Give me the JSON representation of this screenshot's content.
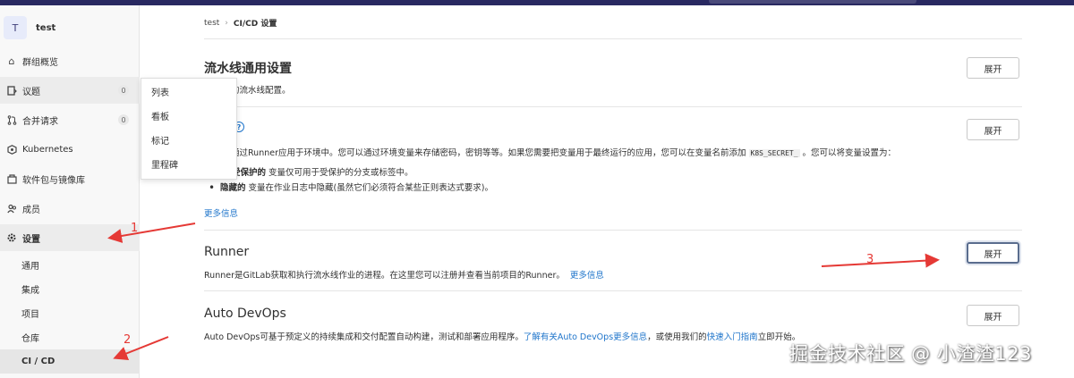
{
  "sidebar": {
    "group": {
      "avatar_letter": "T",
      "name": "test"
    },
    "items": [
      {
        "label": "群组概览",
        "icon": "home-icon"
      },
      {
        "label": "议题",
        "icon": "issues-icon",
        "count": "0"
      },
      {
        "label": "合并请求",
        "icon": "merge-request-icon",
        "count": "0"
      },
      {
        "label": "Kubernetes",
        "icon": "kubernetes-icon"
      },
      {
        "label": "软件包与镜像库",
        "icon": "package-icon"
      },
      {
        "label": "成员",
        "icon": "users-icon"
      },
      {
        "label": "设置",
        "icon": "gear-icon"
      }
    ],
    "settings_sub": [
      "通用",
      "集成",
      "项目",
      "仓库",
      "CI / CD"
    ]
  },
  "flyout": {
    "items": [
      "列表",
      "看板",
      "标记",
      "里程碑"
    ]
  },
  "breadcrumb": {
    "root": "test",
    "current": "CI/CD 设置"
  },
  "sections": {
    "general": {
      "title": "流水线通用设置",
      "desc": "的流水线配置。",
      "button": "展开"
    },
    "variables": {
      "desc_prefix": "通过Runner应用于环境中。您可以通过环境变量来存储密码，密钥等等。如果您需要把变量用于最终运行的应用，您可以在变量名前添加",
      "code": "K8S_SECRET_",
      "desc_suffix": "。您可以将变量设置为：",
      "bullet1_strong": "受保护的",
      "bullet1_rest": " 变量仅可用于受保护的分支或标签中。",
      "bullet2_strong": "隐藏的",
      "bullet2_rest": " 变量在作业日志中隐藏(虽然它们必须符合某些正则表达式要求)。",
      "more": "更多信息",
      "button": "展开"
    },
    "runner": {
      "title": "Runner",
      "desc": "Runner是GitLab获取和执行流水线作业的进程。在这里您可以注册并查看当前项目的Runner。",
      "more": "更多信息",
      "button": "展开"
    },
    "autodevops": {
      "title": "Auto DevOps",
      "desc_prefix": "Auto DevOps可基于预定义的持续集成和交付配置自动构建，测试和部署应用程序。",
      "link1": "了解有关Auto DevOps更多信息",
      "desc_mid": "，或使用我们的",
      "link2": "快速入门指南",
      "desc_suffix": "立即开始。",
      "button": "展开"
    }
  },
  "annotations": [
    "1",
    "2",
    "3"
  ],
  "watermark": "掘金技术社区 @ 小渣渣123",
  "colors": {
    "link": "#1f75cb",
    "arrow": "#e53935",
    "topbar": "#292961"
  }
}
